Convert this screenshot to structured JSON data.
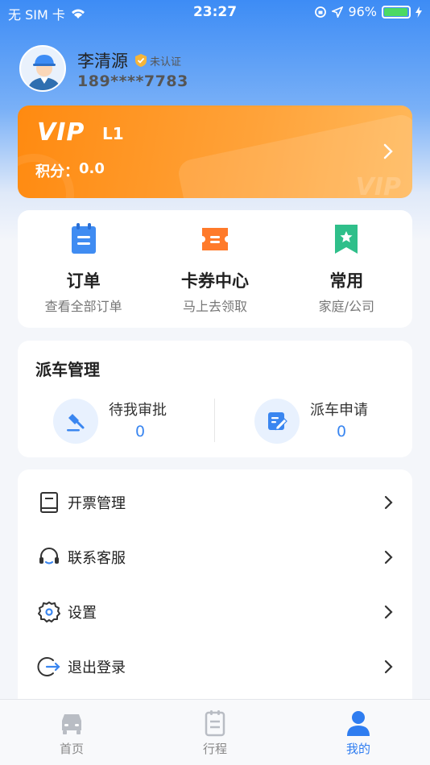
{
  "status_bar": {
    "carrier": "无 SIM 卡",
    "time": "23:27",
    "battery": "96%",
    "battery_level": 0.96
  },
  "profile": {
    "name": "李清源",
    "certification": "未认证",
    "phone": "189****7783"
  },
  "vip": {
    "logo": "VIP",
    "level": "L1",
    "points_label": "积分：",
    "points_value": "0.0",
    "watermark": "VIP"
  },
  "quick_actions": [
    {
      "title": "订单",
      "subtitle": "查看全部订单",
      "icon": "clipboard-icon",
      "color": "#3f8cf2"
    },
    {
      "title": "卡券中心",
      "subtitle": "马上去领取",
      "icon": "ticket-icon",
      "color": "#ff7a2a"
    },
    {
      "title": "常用",
      "subtitle": "家庭/公司",
      "icon": "bookmark-star-icon",
      "color": "#2fbf8a"
    }
  ],
  "dispatch": {
    "title": "派车管理",
    "items": [
      {
        "label": "待我审批",
        "count": "0",
        "icon": "gavel-icon"
      },
      {
        "label": "派车申请",
        "count": "0",
        "icon": "edit-form-icon"
      }
    ]
  },
  "menu": [
    {
      "label": "开票管理",
      "icon": "invoice-book-icon"
    },
    {
      "label": "联系客服",
      "icon": "headset-icon"
    },
    {
      "label": "设置",
      "icon": "gear-icon"
    },
    {
      "label": "退出登录",
      "icon": "logout-icon"
    }
  ],
  "tabs": [
    {
      "label": "首页",
      "icon": "car-icon",
      "active": false
    },
    {
      "label": "行程",
      "icon": "trip-list-icon",
      "active": false
    },
    {
      "label": "我的",
      "icon": "user-icon",
      "active": true
    }
  ],
  "colors": {
    "primary": "#2f7df0",
    "vip_orange": "#ff8a10",
    "accent_blue": "#3a86f0"
  }
}
